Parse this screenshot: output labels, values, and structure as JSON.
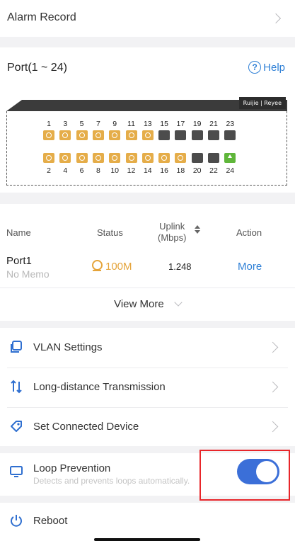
{
  "alarm": {
    "label": "Alarm Record"
  },
  "ports": {
    "title": "Port(1 ~ 24)",
    "help": "Help",
    "brand": "Ruijie | Reyee",
    "top_row": [
      {
        "num": "1",
        "state": "yellow"
      },
      {
        "num": "3",
        "state": "yellow"
      },
      {
        "num": "5",
        "state": "yellow"
      },
      {
        "num": "7",
        "state": "yellow"
      },
      {
        "num": "9",
        "state": "yellow"
      },
      {
        "num": "11",
        "state": "yellow"
      },
      {
        "num": "13",
        "state": "yellow"
      },
      {
        "num": "15",
        "state": "gray"
      },
      {
        "num": "17",
        "state": "gray"
      },
      {
        "num": "19",
        "state": "gray"
      },
      {
        "num": "21",
        "state": "gray"
      },
      {
        "num": "23",
        "state": "gray"
      }
    ],
    "bottom_row": [
      {
        "num": "2",
        "state": "yellow"
      },
      {
        "num": "4",
        "state": "yellow"
      },
      {
        "num": "6",
        "state": "yellow"
      },
      {
        "num": "8",
        "state": "yellow"
      },
      {
        "num": "10",
        "state": "yellow"
      },
      {
        "num": "12",
        "state": "yellow"
      },
      {
        "num": "14",
        "state": "yellow"
      },
      {
        "num": "16",
        "state": "yellow"
      },
      {
        "num": "18",
        "state": "yellow"
      },
      {
        "num": "20",
        "state": "gray"
      },
      {
        "num": "22",
        "state": "gray"
      },
      {
        "num": "24",
        "state": "green"
      }
    ],
    "colors": {
      "yellow": "#e5ad49",
      "gray": "#4c4c4c",
      "green": "#5fb63a"
    }
  },
  "table": {
    "headers": {
      "name": "Name",
      "status": "Status",
      "uplink_line1": "Uplink",
      "uplink_line2": "(Mbps)",
      "action": "Action"
    },
    "row": {
      "name": "Port1",
      "memo": "No Memo",
      "status": "100M",
      "uplink": "1.248",
      "action": "More"
    },
    "view_more": "View More"
  },
  "menu": {
    "vlan": "VLAN Settings",
    "long_distance": "Long-distance Transmission",
    "connected_device": "Set Connected Device"
  },
  "loop": {
    "title": "Loop Prevention",
    "desc": "Detects and prevents loops automatically.",
    "enabled": true
  },
  "reboot": {
    "label": "Reboot"
  }
}
